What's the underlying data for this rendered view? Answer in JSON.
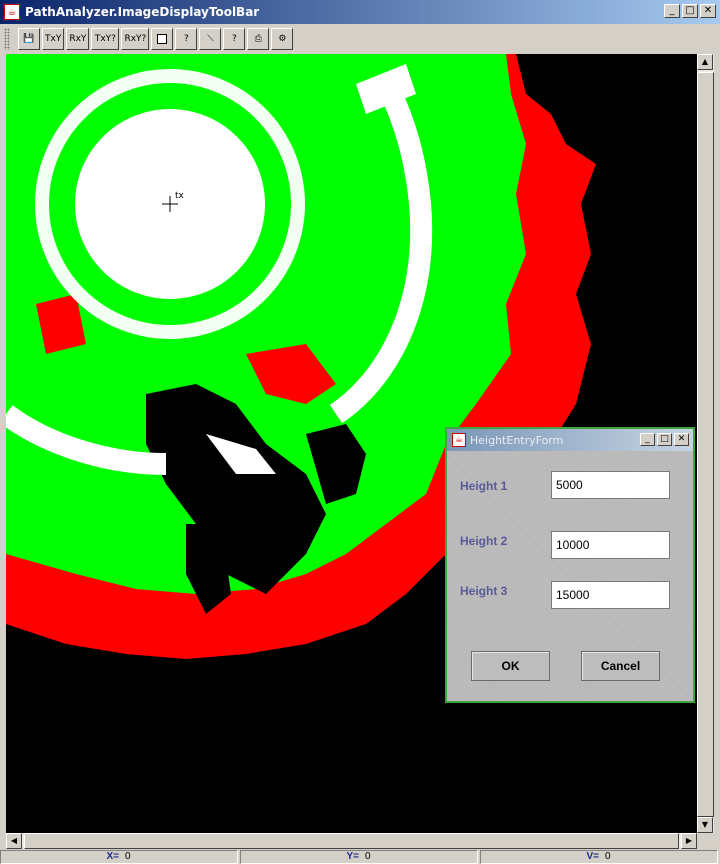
{
  "window": {
    "title": "PathAnalyzer.ImageDisplayToolBar",
    "icon": "java-cup-icon",
    "controls": [
      "_",
      "□",
      "✕"
    ]
  },
  "toolbar": {
    "buttons": [
      {
        "name": "save-icon",
        "label": "💾"
      },
      {
        "name": "tx-antenna-icon",
        "label": "TxY"
      },
      {
        "name": "rx-antenna-icon",
        "label": "RxY"
      },
      {
        "name": "tx-query-icon",
        "label": "TxY?"
      },
      {
        "name": "rx-query-icon",
        "label": "RxY?"
      },
      {
        "name": "square-icon",
        "label": ""
      },
      {
        "name": "square-query-icon",
        "label": "?"
      },
      {
        "name": "line-icon",
        "label": "⟍"
      },
      {
        "name": "query-icon",
        "label": "?"
      },
      {
        "name": "print-icon",
        "label": "⎙"
      },
      {
        "name": "settings-icon",
        "label": "⚙"
      }
    ]
  },
  "canvas": {
    "marker_label": "tx",
    "colors": {
      "background": "#000000",
      "red": "#ff0000",
      "green": "#00ff00",
      "white": "#ffffff"
    }
  },
  "dialog": {
    "title": "HeightEntryForm",
    "fields": [
      {
        "label": "Height 1",
        "value": "5000"
      },
      {
        "label": "Height 2",
        "value": "10000"
      },
      {
        "label": "Height 3",
        "value": "15000"
      }
    ],
    "ok_label": "OK",
    "cancel_label": "Cancel"
  },
  "statusbar": {
    "x_label": "X=",
    "x_value": "0",
    "y_label": "Y=",
    "y_value": "0",
    "v_label": "V=",
    "v_value": "0"
  }
}
